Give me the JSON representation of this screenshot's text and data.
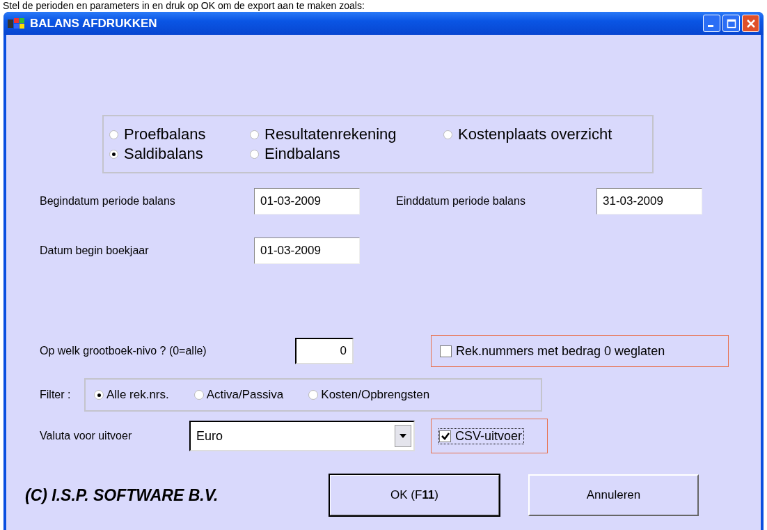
{
  "caption": "Stel de perioden en parameters in en druk op OK om de export aan te maken zoals:",
  "window": {
    "title": "BALANS AFDRUKKEN"
  },
  "report_types": [
    {
      "label": "Proefbalans",
      "selected": false
    },
    {
      "label": "Resultatenrekening",
      "selected": false
    },
    {
      "label": "Kostenplaats overzicht",
      "selected": false
    },
    {
      "label": "Saldibalans",
      "selected": true
    },
    {
      "label": "Eindbalans",
      "selected": false
    }
  ],
  "begin_date": {
    "label": "Begindatum periode balans",
    "value": "01-03-2009"
  },
  "end_date": {
    "label": "Einddatum  periode balans",
    "value": "31-03-2009"
  },
  "fiscal_year_start": {
    "label": "Datum begin boekjaar",
    "value": "01-03-2009"
  },
  "ledger_level": {
    "label": "Op welk grootboek-nivo ? (0=alle)",
    "value": "0"
  },
  "omit_zero": {
    "label": "Rek.nummers met bedrag 0 weglaten",
    "checked": false
  },
  "filter": {
    "label": "Filter :",
    "options": [
      {
        "label": "Alle rek.nrs.",
        "selected": true
      },
      {
        "label": "Activa/Passiva",
        "selected": false
      },
      {
        "label": "Kosten/Opbrengsten",
        "selected": false
      }
    ]
  },
  "currency": {
    "label": "Valuta voor uitvoer",
    "value": "Euro"
  },
  "csv": {
    "label": "CSV-uitvoer",
    "checked": true
  },
  "copyright": "(C) I.S.P. SOFTWARE B.V.",
  "buttons": [
    {
      "label": "OK (F**11**)"
    },
    {
      "label": "Annuleren"
    }
  ]
}
